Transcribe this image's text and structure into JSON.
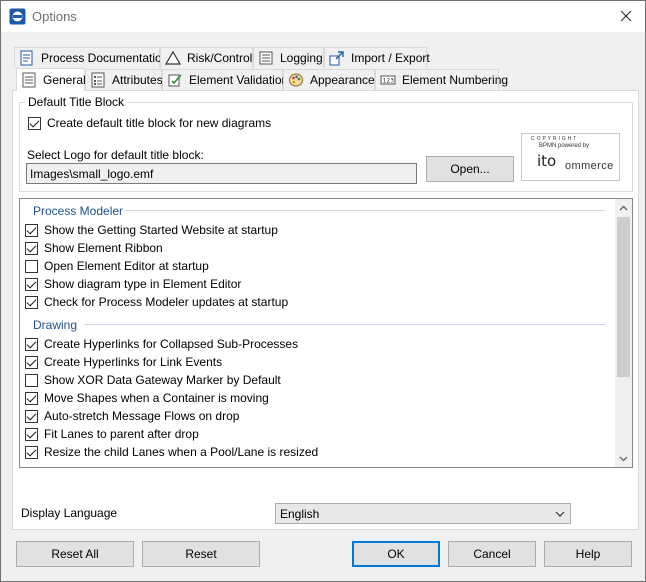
{
  "window": {
    "title": "Options"
  },
  "tabs_row1": [
    {
      "label": "Process Documentation",
      "icon": "document-icon"
    },
    {
      "label": "Risk/Control",
      "icon": "warning-triangle-icon"
    },
    {
      "label": "Logging",
      "icon": "log-list-icon"
    },
    {
      "label": "Import / Export",
      "icon": "import-export-icon"
    }
  ],
  "tabs_row2": [
    {
      "label": "General",
      "icon": "general-list-icon",
      "active": true
    },
    {
      "label": "Attributes",
      "icon": "attributes-list-icon"
    },
    {
      "label": "Element Validation",
      "icon": "validation-icon"
    },
    {
      "label": "Appearance",
      "icon": "palette-icon"
    },
    {
      "label": "Element Numbering",
      "icon": "numbering-icon"
    }
  ],
  "title_block": {
    "legend": "Default Title Block",
    "create_default": {
      "label": "Create default title block for new diagrams",
      "checked": true
    },
    "logo_label": "Select Logo for default title block:",
    "logo_path": "Images\\small_logo.emf",
    "open_button": "Open...",
    "logo_preview": {
      "line1": "C O P Y R I G H T",
      "line2": "BPMN powered by",
      "mark": "ito",
      "word": "ommerce"
    }
  },
  "list": {
    "sections": [
      {
        "title": "Process Modeler",
        "items": [
          {
            "label": "Show the Getting Started Website at startup",
            "checked": true
          },
          {
            "label": "Show Element Ribbon",
            "checked": true
          },
          {
            "label": "Open Element Editor at startup",
            "checked": false
          },
          {
            "label": "Show diagram type in Element Editor",
            "checked": true
          },
          {
            "label": "Check for Process Modeler updates at startup",
            "checked": true
          }
        ]
      },
      {
        "title": "Drawing",
        "items": [
          {
            "label": "Create Hyperlinks for Collapsed Sub-Processes",
            "checked": true
          },
          {
            "label": "Create Hyperlinks for Link Events",
            "checked": true
          },
          {
            "label": "Show XOR Data Gateway Marker by Default",
            "checked": false
          },
          {
            "label": "Move Shapes when a Container is moving",
            "checked": true
          },
          {
            "label": "Auto-stretch Message Flows on drop",
            "checked": true
          },
          {
            "label": "Fit Lanes to parent after drop",
            "checked": true
          },
          {
            "label": "Resize the child Lanes when a Pool/Lane is resized",
            "checked": true
          }
        ]
      }
    ]
  },
  "display_language": {
    "label": "Display Language",
    "value": "English"
  },
  "buttons": {
    "reset_all": "Reset All",
    "reset": "Reset",
    "ok": "OK",
    "cancel": "Cancel",
    "help": "Help"
  },
  "colors": {
    "accent": "#0078d7",
    "section_header": "#1f4e8c"
  }
}
